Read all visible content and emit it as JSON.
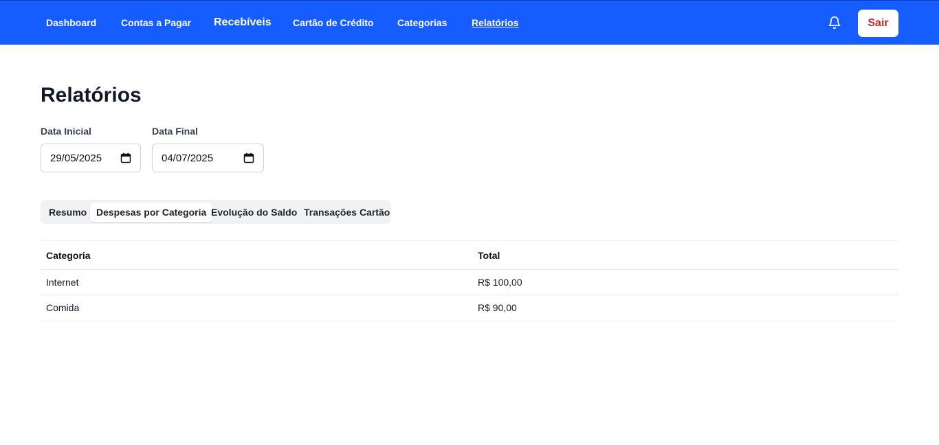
{
  "nav": {
    "items": [
      {
        "label": "Dashboard"
      },
      {
        "label": "Contas a Pagar"
      },
      {
        "label": "Recebíveis"
      },
      {
        "label": "Cartão de Crédito"
      },
      {
        "label": "Categorias"
      },
      {
        "label": "Relatórios",
        "active": true
      }
    ],
    "logout_label": "Sair",
    "bell_icon": "bell-icon"
  },
  "page": {
    "title": "Relatórios"
  },
  "filters": {
    "start": {
      "label": "Data Inicial",
      "value": "29/05/2025"
    },
    "end": {
      "label": "Data Final",
      "value": "04/07/2025"
    }
  },
  "tabs": [
    {
      "label": "Resumo"
    },
    {
      "label": "Despesas por Categoria",
      "active": true
    },
    {
      "label": "Evolução do Saldo"
    },
    {
      "label": "Transações Cartão"
    }
  ],
  "table": {
    "headers": [
      "Categoria",
      "Total"
    ],
    "rows": [
      [
        "Internet",
        "R$ 100,00"
      ],
      [
        "Comida",
        "R$ 90,00"
      ]
    ]
  },
  "colors": {
    "topbar": "#165dff",
    "logout_text": "#e11d2a"
  }
}
